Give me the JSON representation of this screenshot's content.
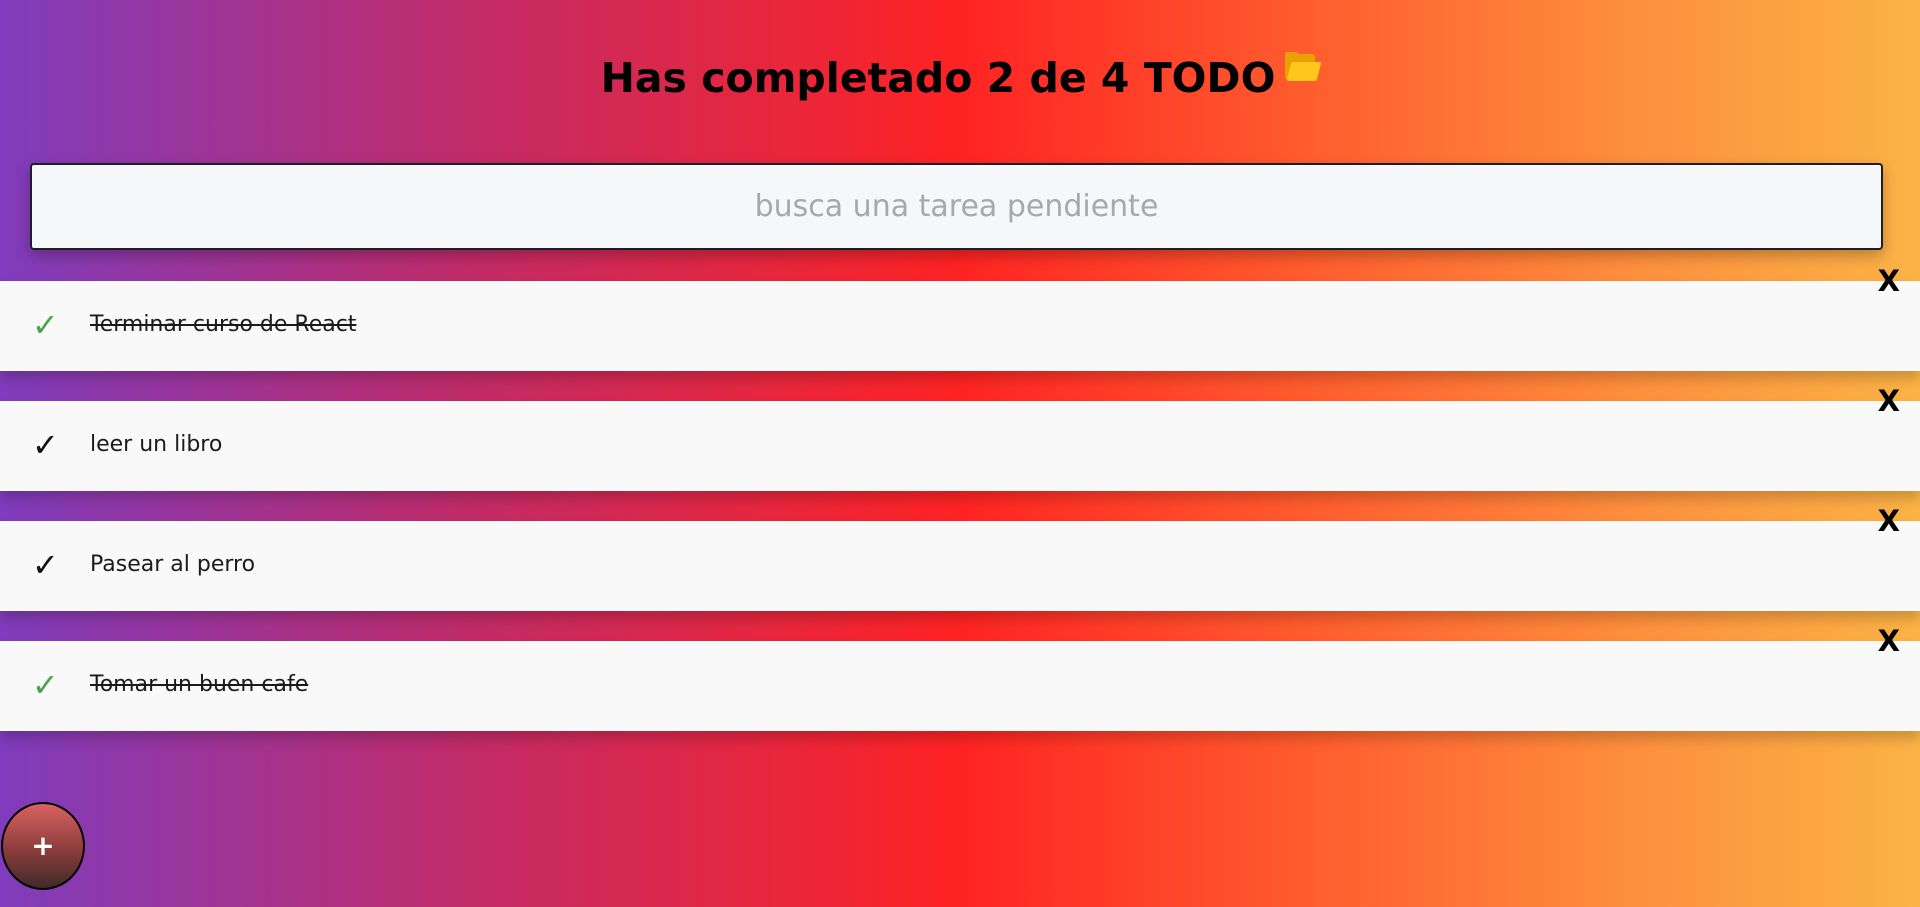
{
  "header": {
    "title": "Has completado 2 de 4 TODO",
    "title_icon": "open-folder-icon"
  },
  "search": {
    "placeholder": "busca una tarea pendiente",
    "value": ""
  },
  "todos": [
    {
      "text": "Terminar curso de React",
      "completed": true,
      "check_glyph": "✓",
      "delete_label": "X"
    },
    {
      "text": "leer un libro",
      "completed": false,
      "check_glyph": "✓",
      "delete_label": "X"
    },
    {
      "text": "Pasear al perro",
      "completed": false,
      "check_glyph": "✓",
      "delete_label": "X"
    },
    {
      "text": "Tomar un buen cafe",
      "completed": true,
      "check_glyph": "✓",
      "delete_label": "X"
    }
  ],
  "fab": {
    "label": "+"
  },
  "colors": {
    "completed_check": "#4aa64a",
    "pending_check": "#111111",
    "card_background": "#f9f9f9",
    "gradient": [
      "#7f3cbd",
      "#c22b66",
      "#ff2323",
      "#ff5c2e",
      "#fd8f3d",
      "#fbb346"
    ]
  }
}
